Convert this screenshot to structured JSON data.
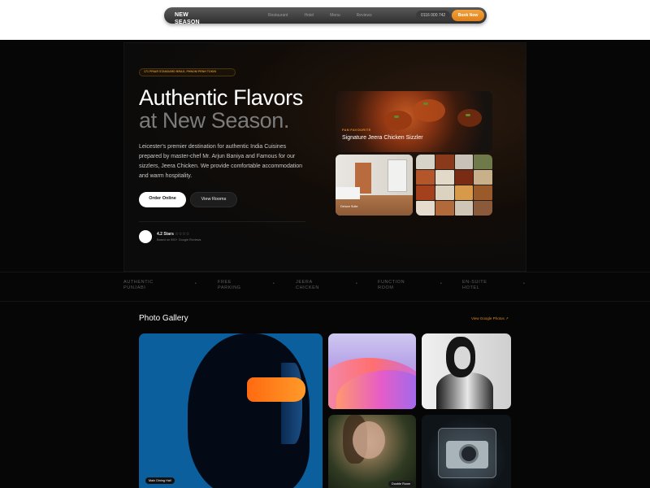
{
  "nav": {
    "brand": "NEW SEASON",
    "links": [
      "Restaurant",
      "Hotel",
      "Menu",
      "Reviews"
    ],
    "phone": "0116 000 742",
    "book_label": "Book Now"
  },
  "hero": {
    "address": "171 FRIAR STANDARD BRAG, PHNOM PENH TOKIN",
    "headline_1": "Authentic Flavors",
    "headline_2": "at New Season.",
    "description": "Leicester's premier destination for authentic India Cuisines prepared by master-chef Mr. Arjun Baniya and Famous for our sizzlers, Jeera Chicken. We provide comfortable accommodation and warm hospitality.",
    "order_label": "Order Online",
    "rooms_label": "View Rooms",
    "rating_text": "4.2 Stars",
    "rating_stars": "☆☆☆☆",
    "reviews_text": "Based on 900+ Google Reviews",
    "signature_tag": "FAN FAVOURITE",
    "signature_title": "Signature Jeera Chicken Sizzler",
    "room_caption": "Deluxe Suite"
  },
  "strip": {
    "items": [
      "AUTHENTIC PUNJABI",
      "FREE PARKING",
      "JEERA CHICKEN",
      "FUNCTION ROOM",
      "EN-SUITE HOTEL"
    ],
    "separator": "•"
  },
  "gallery": {
    "title": "Photo Gallery",
    "link_label": "View Google Photos  ↗",
    "big_label": "Main Dining Hall",
    "blur_label": "Double Room"
  },
  "colors": {
    "accent": "#e08a1e",
    "background": "#060606"
  }
}
